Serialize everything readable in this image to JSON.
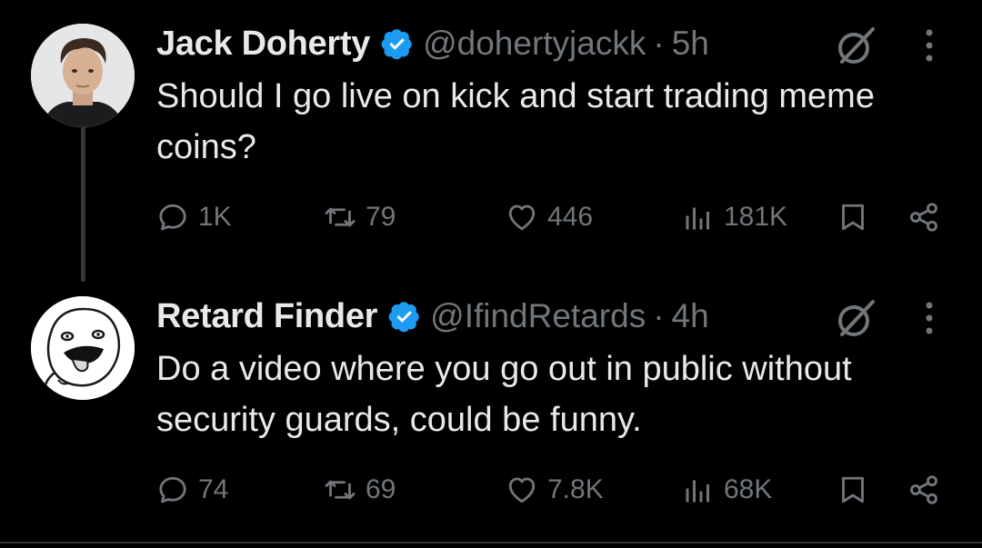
{
  "tweets": [
    {
      "name": "Jack Doherty",
      "handle": "@dohertyjackk",
      "separator": "·",
      "time": "5h",
      "text": "Should I go live on kick and start trading meme coins?",
      "avatar": "profile-photo",
      "stats": {
        "replies": "1K",
        "retweets": "79",
        "likes": "446",
        "views": "181K"
      }
    },
    {
      "name": "Retard Finder",
      "handle": "@IfindRetards",
      "separator": "·",
      "time": "4h",
      "text": "Do a video where you go out in public without security guards, could be funny.",
      "avatar": "meme-face",
      "stats": {
        "replies": "74",
        "retweets": "69",
        "likes": "7.8K",
        "views": "68K"
      }
    }
  ],
  "icons": {
    "verified": "verified-badge-icon",
    "grok": "grok-icon",
    "more": "more-vertical-icon",
    "reply": "reply-icon",
    "retweet": "retweet-icon",
    "like": "heart-icon",
    "views": "views-icon",
    "bookmark": "bookmark-icon",
    "share": "share-icon"
  },
  "colors": {
    "background": "#000000",
    "text": "#e7e9ea",
    "muted": "#71767b",
    "verified": "#1d9bf0",
    "thread_line": "#333639"
  }
}
